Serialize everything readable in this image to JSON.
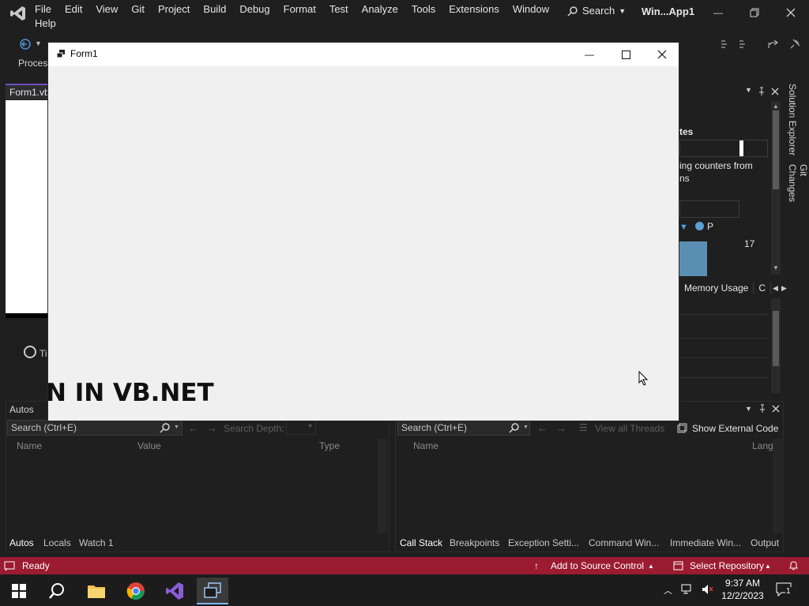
{
  "menubar": {
    "items": [
      "File",
      "Edit",
      "View",
      "Git",
      "Project",
      "Build",
      "Debug",
      "Format",
      "Test",
      "Analyze",
      "Tools",
      "Extensions",
      "Window"
    ],
    "help": "Help",
    "search_label": "Search",
    "solution_title": "Win...App1"
  },
  "toolbar": {
    "process_label": "Proces"
  },
  "document": {
    "tab_label": "Form1.vb",
    "timer_label": "Ti"
  },
  "diagnostics": {
    "events_label": "tes",
    "counters_text_line1": "ing counters from",
    "counters_text_line2": "ns",
    "legend_p": "P",
    "value_17": "17",
    "tabs": [
      "Memory Usage",
      "C"
    ]
  },
  "side_tabs": [
    "Solution Explorer",
    "Git Changes"
  ],
  "form_window": {
    "title": "Form1"
  },
  "overlay": {
    "text": "N IN VB.NET"
  },
  "autos_pane": {
    "title": "Autos",
    "search_placeholder": "Search (Ctrl+E)",
    "search_depth": "Search Depth:",
    "columns": [
      "Name",
      "Value",
      "Type"
    ],
    "tabs": [
      "Autos",
      "Locals",
      "Watch 1"
    ]
  },
  "callstack_pane": {
    "search_placeholder": "Search (Ctrl+E)",
    "view_threads": "View all Threads",
    "show_external": "Show External Code",
    "columns": [
      "Name",
      "Lang"
    ],
    "tabs": [
      "Call Stack",
      "Breakpoints",
      "Exception Setti...",
      "Command Win...",
      "Immediate Win...",
      "Output"
    ]
  },
  "statusbar": {
    "ready": "Ready",
    "add_source": "Add to Source Control",
    "select_repo": "Select Repository",
    "color": "#9b1b30"
  },
  "taskbar": {
    "time": "9:37 AM",
    "date": "12/2/2023",
    "notification_count": "1"
  }
}
